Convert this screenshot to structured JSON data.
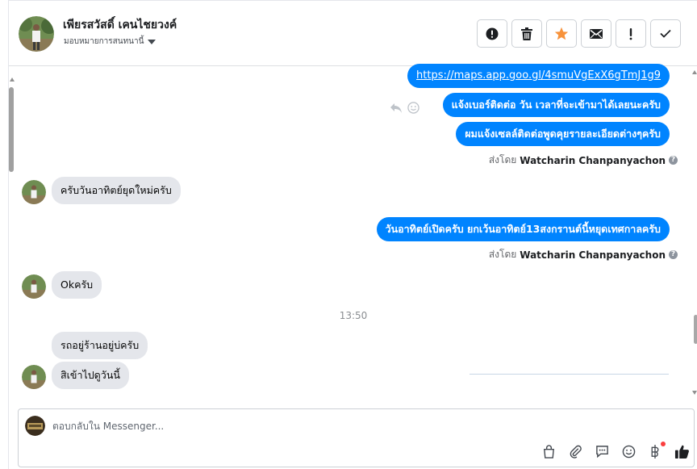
{
  "header": {
    "contact_name": "เพียรสวัสดิ์ เคนไชยวงค์",
    "assign_label": "มอบหมายการสนทนานี้"
  },
  "actions": [
    {
      "name": "mark-spam-button",
      "icon": "alert-circle-icon"
    },
    {
      "name": "delete-button",
      "icon": "trash-icon"
    },
    {
      "name": "star-button",
      "icon": "star-icon",
      "color": "#f7923b"
    },
    {
      "name": "mark-unread-button",
      "icon": "envelope-icon"
    },
    {
      "name": "follow-up-button",
      "icon": "exclamation-icon"
    },
    {
      "name": "mark-done-button",
      "icon": "checkmark-icon"
    }
  ],
  "messages": {
    "m1_link": "https://maps.app.goo.gl/4smuVgExX6gTmJ1g9",
    "m2": "แจ้งเบอร์ติดต่อ วัน เวลาที่จะเข้ามาได้เลยนะครับ",
    "m3": "ผมแจ้งเซลล์ติดต่อพูดคุยรายละเอียดต่างๆครับ",
    "sent_by_prefix": "ส่งโดย",
    "sent_by_name": "Watcharin Chanpanyachon",
    "m4": "ครับวันอาทิตย์ยุดใหม่ครับ",
    "m5": "วันอาทิตย์เปิดครับ ยกเว้นอาทิตย์13สงกรานต์นี้หยุดเทศกาลครับ",
    "m6": "Okครับ",
    "timestamp": "13:50",
    "m7": "รถอยู่ร้านอยู่บ่ครับ",
    "m8": "สิเข้าไปดูวันนี้"
  },
  "composer": {
    "placeholder": "ตอบกลับใน Messenger..."
  },
  "colors": {
    "outgoing_bubble": "#0084ff",
    "incoming_bubble": "#e4e6eb",
    "like_icon": "#1c1e21"
  }
}
